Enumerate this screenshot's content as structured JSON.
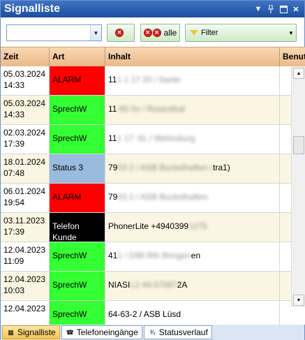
{
  "window": {
    "title": "Signalliste"
  },
  "titlebar_icons": [
    "dropdown-icon",
    "pin-icon",
    "maximize-icon",
    "close-icon"
  ],
  "toolbar": {
    "combo_value": "",
    "clear_label": "",
    "clear_all_label": "alle",
    "filter_label": "Filter"
  },
  "table": {
    "columns": [
      "Zeit",
      "Art",
      "Inhalt",
      "Benut"
    ],
    "rows": [
      {
        "date": "05.03.2024",
        "time": "14:33",
        "art": "ALARM",
        "art_bg": "#ff0000",
        "art_fg": "#000000",
        "inh_prefix": "11",
        "inh_blur": "1 1 17 20 / Sante",
        "inh_suffix": ""
      },
      {
        "date": "05.03.2024",
        "time": "14:33",
        "art": "SprechW",
        "art_bg": "#33ff33",
        "art_fg": "#000000",
        "inh_prefix": "11",
        "inh_blur": "-60 5s / Rosenthal",
        "inh_suffix": ""
      },
      {
        "date": "02.03.2024",
        "time": "17:39",
        "art": "SprechW",
        "art_bg": "#33ff33",
        "art_fg": "#000000",
        "inh_prefix": "11",
        "inh_blur": "1 17 -5L / Wehrsburg",
        "inh_suffix": ""
      },
      {
        "date": "18.01.2024",
        "time": "07:48",
        "art": "Status 3",
        "art_bg": "#99bbdd",
        "art_fg": "#000000",
        "inh_prefix": "79",
        "inh_blur": "03 2 / ASB Buckelhaften (",
        "inh_suffix": "tra1)"
      },
      {
        "date": "06.01.2024",
        "time": "19:54",
        "art": "ALARM",
        "art_bg": "#ff0000",
        "art_fg": "#000000",
        "inh_prefix": "79",
        "inh_blur": "03 2 / ASB Buckelhaften",
        "inh_suffix": ""
      },
      {
        "date": "03.11.2023",
        "time": "17:39",
        "art": "Telefon\nKunde",
        "art_bg": "#000000",
        "art_fg": "#ffffff",
        "inh_prefix": "PhonerLite +4940399",
        "inh_blur": "1275",
        "inh_suffix": ""
      },
      {
        "date": "12.04.2023",
        "time": "11:09",
        "art": "SprechW",
        "art_bg": "#33ff33",
        "art_fg": "#000000",
        "inh_prefix": "41",
        "inh_blur": "1 / D96 Rth Bringen",
        "inh_suffix": "en"
      },
      {
        "date": "12.04.2023",
        "time": "10:03",
        "art": "SprechW",
        "art_bg": "#33ff33",
        "art_fg": "#000000",
        "inh_prefix": "NIASI",
        "inh_blur": "L2 44-57087",
        "inh_suffix": " 2A"
      },
      {
        "date": "12.04.2023",
        "time": "",
        "art": "SprechW",
        "art_bg": "#33ff33",
        "art_fg": "#000000",
        "inh_prefix": "64-63-2 / ASB Lüs",
        "inh_blur": "",
        "inh_suffix": "d"
      }
    ]
  },
  "tabs": [
    {
      "label": "Signalliste",
      "icon": "list-icon",
      "active": true
    },
    {
      "label": "Telefoneingänge",
      "icon": "phone-icon",
      "active": false
    },
    {
      "label": "Statusverlauf",
      "icon": "status-icon",
      "active": false
    }
  ]
}
